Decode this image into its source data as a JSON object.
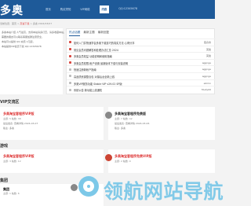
{
  "header": {
    "logo": "多奥",
    "nav": [
      "首页",
      "购买须知",
      "VIP网络",
      "内容",
      "QQ:12345678"
    ],
    "active_index": 3
  },
  "breadcrumb": {
    "prefix": "当前位置：首页 > ",
    "highlight": "高速下载",
    "suffix": " > 多奥  2024/03/07"
  },
  "left_panel": {
    "lines": [
      "多奥本站介绍 人气最高，支持本站请多打赏，请多收藏本站，",
      "需要的朋友可以联系客服加群注意安全，",
      "本站可以提供  QQ 充值 1元起，",
      "本站提供VIP会员下载 QQ:12345678"
    ]
  },
  "right_panel": {
    "tabs": [
      "热点话题",
      "最新主题",
      "最新回复"
    ],
    "active_tab": 0,
    "rows": [
      {
        "title": "如何入门并快速学会多奥下载技巧的真实方法 心得分享",
        "author": "孤舟寒",
        "hot": true
      },
      {
        "title": "常见会员问题解答和处理办法汇总 2024",
        "author": "英俊",
        "hot": true
      },
      {
        "title": "多奥会员权益 功能说明和使用指南",
        "author": "英俊",
        "hot": true
      },
      {
        "title": "多奥会员权限-帐户设置 最新版本下载与安装说明",
        "author": "aggnge",
        "hot": true
      },
      {
        "title": "快速注册新帐户指南",
        "author": "aggnge",
        "hot": false
      },
      {
        "title": "高品质资源整合包 对接后台全新上线",
        "author": "aggnge",
        "hot": false
      },
      {
        "title": "多奥VIP服务功能 Stable VIP v29.02 SP版",
        "author": "admin",
        "hot": false
      },
      {
        "title": "系统公告 新功能上线通知",
        "author": "Mudy00",
        "hot": false
      }
    ]
  },
  "sections": [
    {
      "title": "VIP交流区"
    },
    {
      "title": "游戏"
    },
    {
      "title": "集团"
    }
  ],
  "cards": {
    "vip_left": {
      "title": "多奥淘宝客程序VIP版",
      "sub": "主题: 5    帖数: 38",
      "lines": [
        "最后发表: 查看详情 2024-03-07",
        "版主: 多奥"
      ]
    },
    "vip_right": {
      "title": "多奥淘宝客程序免费版",
      "sub": "主题: 7    帖数: 42",
      "lines": [
        "最后发表: 查看详情 2024-03-06",
        "版主: 多奥"
      ]
    },
    "game_left": {
      "title": "多奥淘宝客程序VIP版",
      "sub": "主题: 3    帖数: 12"
    },
    "game_right": {
      "title": "多奥淘宝客程序免费VIP版",
      "sub": "主题: 2    帖数: 9"
    },
    "group_left": {
      "title": "集团",
      "sub": "主题: 1    帖数: 6"
    },
    "group_right": {
      "title": "多奥",
      "sub": "主题: 4"
    }
  },
  "watermark": {
    "text": "领航网站导航"
  }
}
